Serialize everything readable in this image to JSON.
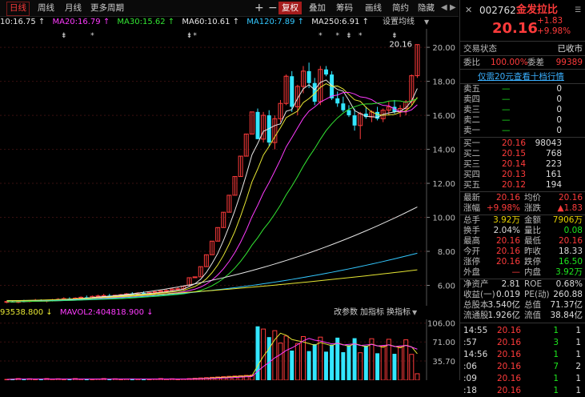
{
  "toolbar": {
    "tabs": [
      "日线",
      "周线",
      "月线",
      "更多周期"
    ],
    "buttons": [
      "复权",
      "叠加",
      "筹码",
      "画线",
      "简约",
      "隐藏"
    ]
  },
  "ma_line": [
    {
      "label": "10:16.75 ↑",
      "color": "#e6e6e6"
    },
    {
      "label": "MA20:16.79 ↑",
      "color": "#ff3bff"
    },
    {
      "label": "MA30:15.62 ↑",
      "color": "#33e633"
    },
    {
      "label": "MA60:10.61 ↑",
      "color": "#e6e6e6"
    },
    {
      "label": "MA120:7.89 ↑",
      "color": "#33c8ff"
    },
    {
      "label": "MA250:6.91 ↑",
      "color": "#e6e6e6"
    }
  ],
  "settings_label": "设置均线",
  "chart_data": [
    {
      "type": "candlestick",
      "y_ticks": [
        "20.00",
        "18.00",
        "16.00",
        "14.00",
        "12.00",
        "10.00",
        "8.00",
        "6.00"
      ],
      "ylim": [
        4.8,
        20.9
      ],
      "last_price_label": "20.16",
      "candles": [
        [
          5.0,
          5.1,
          4.95,
          5.05
        ],
        [
          5.05,
          5.1,
          5.0,
          5.0
        ],
        [
          5.0,
          5.1,
          4.95,
          5.08
        ],
        [
          5.08,
          5.15,
          5.0,
          5.05
        ],
        [
          5.05,
          5.12,
          5.0,
          5.1
        ],
        [
          5.1,
          5.2,
          5.05,
          5.12
        ],
        [
          5.12,
          5.18,
          5.05,
          5.08
        ],
        [
          5.08,
          5.15,
          5.0,
          5.12
        ],
        [
          5.12,
          5.2,
          5.05,
          5.15
        ],
        [
          5.15,
          5.25,
          5.1,
          5.18
        ],
        [
          5.18,
          5.3,
          5.12,
          5.22
        ],
        [
          5.22,
          5.3,
          5.15,
          5.2
        ],
        [
          5.2,
          5.3,
          5.12,
          5.25
        ],
        [
          5.25,
          5.35,
          5.2,
          5.3
        ],
        [
          5.3,
          5.4,
          5.22,
          5.28
        ],
        [
          5.28,
          5.4,
          5.2,
          5.35
        ],
        [
          5.35,
          5.45,
          5.3,
          5.38
        ],
        [
          5.38,
          5.5,
          5.3,
          5.4
        ],
        [
          5.4,
          5.5,
          5.3,
          5.35
        ],
        [
          5.35,
          5.45,
          5.25,
          5.42
        ],
        [
          5.42,
          5.5,
          5.35,
          5.45
        ],
        [
          5.45,
          5.55,
          5.38,
          5.5
        ],
        [
          5.5,
          5.6,
          5.42,
          5.48
        ],
        [
          5.48,
          5.6,
          5.4,
          5.55
        ],
        [
          5.55,
          5.65,
          5.45,
          5.5
        ],
        [
          5.5,
          5.6,
          5.42,
          5.58
        ],
        [
          5.58,
          5.7,
          5.5,
          5.62
        ],
        [
          5.62,
          5.75,
          5.55,
          5.68
        ],
        [
          5.68,
          5.8,
          5.6,
          5.7
        ],
        [
          5.7,
          5.85,
          5.62,
          5.78
        ],
        [
          5.78,
          5.9,
          5.7,
          5.8
        ],
        [
          5.8,
          6.0,
          5.72,
          5.95
        ],
        [
          6.0,
          6.45,
          5.95,
          6.45
        ],
        [
          6.45,
          6.5,
          6.45,
          6.5
        ],
        [
          6.5,
          7.1,
          6.5,
          7.1
        ],
        [
          7.1,
          7.8,
          7.1,
          7.8
        ],
        [
          7.8,
          8.6,
          7.8,
          8.6
        ],
        [
          8.6,
          9.4,
          8.6,
          9.4
        ],
        [
          9.4,
          10.3,
          9.4,
          10.3
        ],
        [
          10.3,
          11.3,
          10.3,
          11.3
        ],
        [
          11.3,
          12.4,
          11.3,
          12.4
        ],
        [
          12.4,
          13.6,
          12.4,
          13.6
        ],
        [
          13.6,
          14.9,
          13.6,
          14.9
        ],
        [
          14.9,
          16.2,
          14.9,
          16.2
        ],
        [
          16.2,
          16.4,
          14.6,
          14.6
        ],
        [
          14.6,
          16.2,
          14.4,
          16.0
        ],
        [
          16.0,
          16.3,
          14.2,
          14.4
        ],
        [
          14.4,
          16.0,
          14.0,
          15.8
        ],
        [
          15.8,
          16.9,
          15.6,
          16.7
        ],
        [
          16.7,
          18.4,
          16.6,
          18.3
        ],
        [
          18.3,
          18.6,
          16.2,
          16.5
        ],
        [
          16.5,
          17.8,
          16.0,
          17.7
        ],
        [
          17.7,
          18.9,
          17.3,
          18.6
        ],
        [
          18.6,
          19.1,
          17.6,
          17.9
        ],
        [
          17.9,
          18.2,
          16.6,
          16.8
        ],
        [
          16.8,
          18.9,
          16.6,
          18.7
        ],
        [
          18.7,
          18.9,
          18.3,
          18.4
        ],
        [
          18.4,
          18.6,
          16.9,
          17.0
        ],
        [
          17.0,
          17.4,
          16.5,
          16.7
        ],
        [
          16.7,
          17.1,
          16.2,
          16.3
        ],
        [
          16.3,
          16.6,
          15.9,
          16.0
        ],
        [
          16.0,
          16.4,
          15.1,
          15.4
        ],
        [
          15.4,
          16.2,
          14.6,
          16.1
        ],
        [
          16.1,
          16.5,
          15.8,
          15.9
        ],
        [
          15.9,
          16.3,
          15.6,
          16.2
        ],
        [
          16.2,
          16.5,
          15.7,
          15.8
        ],
        [
          15.8,
          16.4,
          15.6,
          16.3
        ],
        [
          16.3,
          16.8,
          16.0,
          16.5
        ],
        [
          16.5,
          16.9,
          16.1,
          16.2
        ],
        [
          16.2,
          16.6,
          15.9,
          16.4
        ],
        [
          16.4,
          16.9,
          16.0,
          16.8
        ],
        [
          16.8,
          18.4,
          16.6,
          18.33
        ],
        [
          18.33,
          20.16,
          18.2,
          20.16
        ]
      ],
      "ma_series": [
        {
          "color": "#e6e6e6",
          "key": "ma10"
        },
        {
          "color": "#e6e633",
          "key": "ma_yellow"
        },
        {
          "color": "#ff3bff",
          "key": "ma20"
        },
        {
          "color": "#33e633",
          "key": "ma30"
        },
        {
          "color": "#e6e6e6",
          "key": "ma60"
        },
        {
          "color": "#33c8ff",
          "key": "ma120"
        },
        {
          "color": "#e6e633",
          "key": "ma250"
        }
      ],
      "markers_star": [
        15,
        33,
        55,
        58,
        62
      ],
      "markers_arrow": [
        0,
        52,
        66
      ]
    },
    {
      "type": "bar",
      "title_left": "93538.800 ↓",
      "title_mid": "MAVOL2:404818.900 ↓",
      "buttons": [
        "改参数",
        "加指标",
        "换指标"
      ],
      "y_ticks": [
        "106.00",
        "71.00",
        "35.70"
      ],
      "ylim": [
        0,
        110
      ]
    }
  ],
  "quote": {
    "code": "002762",
    "name": "金发拉比",
    "price": "20.16",
    "change": "+1.83",
    "pct": "+9.98%",
    "status_label": "交易状态",
    "status_value": "已收市",
    "wei_bi_label": "委比",
    "wei_bi": "100.00%",
    "wei_cha_label": "委差",
    "wei_cha": "99389",
    "promo": "仅需20元查看十档行情",
    "sells": [
      {
        "label": "卖五",
        "price": "—",
        "vol": "0"
      },
      {
        "label": "卖四",
        "price": "—",
        "vol": "0"
      },
      {
        "label": "卖三",
        "price": "—",
        "vol": "0"
      },
      {
        "label": "卖二",
        "price": "—",
        "vol": "0"
      },
      {
        "label": "卖一",
        "price": "—",
        "vol": "0"
      }
    ],
    "buys": [
      {
        "label": "买一",
        "price": "20.16",
        "vol": "98043"
      },
      {
        "label": "买二",
        "price": "20.15",
        "vol": "768"
      },
      {
        "label": "买三",
        "price": "20.14",
        "vol": "223"
      },
      {
        "label": "买四",
        "price": "20.13",
        "vol": "161"
      },
      {
        "label": "买五",
        "price": "20.12",
        "vol": "194"
      }
    ],
    "stats": [
      [
        {
          "l": "最新",
          "v": "20.16",
          "c": "red"
        },
        {
          "l": "均价",
          "v": "20.16",
          "c": "red"
        }
      ],
      [
        {
          "l": "涨幅",
          "v": "+9.98%",
          "c": "red"
        },
        {
          "l": "涨跌",
          "v": "▲1.83",
          "c": "red"
        }
      ],
      [
        {
          "l": "总手",
          "v": "3.92万",
          "c": "yellow"
        },
        {
          "l": "金额",
          "v": "7906万",
          "c": "yellow"
        }
      ],
      [
        {
          "l": "换手",
          "v": "2.04%",
          "c": "white"
        },
        {
          "l": "量比",
          "v": "0.08",
          "c": "green"
        }
      ],
      [
        {
          "l": "最高",
          "v": "20.16",
          "c": "red"
        },
        {
          "l": "最低",
          "v": "20.16",
          "c": "red"
        }
      ],
      [
        {
          "l": "今开",
          "v": "20.16",
          "c": "red"
        },
        {
          "l": "昨收",
          "v": "18.33",
          "c": "white"
        }
      ],
      [
        {
          "l": "涨停",
          "v": "20.16",
          "c": "red"
        },
        {
          "l": "跌停",
          "v": "16.50",
          "c": "green"
        }
      ],
      [
        {
          "l": "外盘",
          "v": "—",
          "c": "red"
        },
        {
          "l": "内盘",
          "v": "3.92万",
          "c": "green"
        }
      ],
      [
        {
          "l": "净资产",
          "v": "2.81",
          "c": "white"
        },
        {
          "l": "ROE",
          "v": "0.68%",
          "c": "white"
        }
      ],
      [
        {
          "l": "收益(一)",
          "v": "0.019",
          "c": "white"
        },
        {
          "l": "PE(动)",
          "v": "260.88",
          "c": "white"
        }
      ],
      [
        {
          "l": "总股本",
          "v": "3.540亿",
          "c": "white"
        },
        {
          "l": "总值",
          "v": "71.37亿",
          "c": "white"
        }
      ],
      [
        {
          "l": "流通股",
          "v": "1.926亿",
          "c": "white"
        },
        {
          "l": "流值",
          "v": "38.84亿",
          "c": "white"
        }
      ]
    ],
    "ticks": [
      {
        "t": "14:55",
        "p": "20.16",
        "v": "1",
        "n": "1"
      },
      {
        "t": ":57",
        "p": "20.16",
        "v": "3",
        "n": "1"
      },
      {
        "t": "14:56",
        "p": "20.16",
        "v": "1",
        "n": "1"
      },
      {
        "t": ":06",
        "p": "20.16",
        "v": "7",
        "n": "2"
      },
      {
        "t": ":09",
        "p": "20.16",
        "v": "1",
        "n": "1"
      },
      {
        "t": ":18",
        "p": "20.16",
        "v": "1",
        "n": "1"
      }
    ]
  }
}
